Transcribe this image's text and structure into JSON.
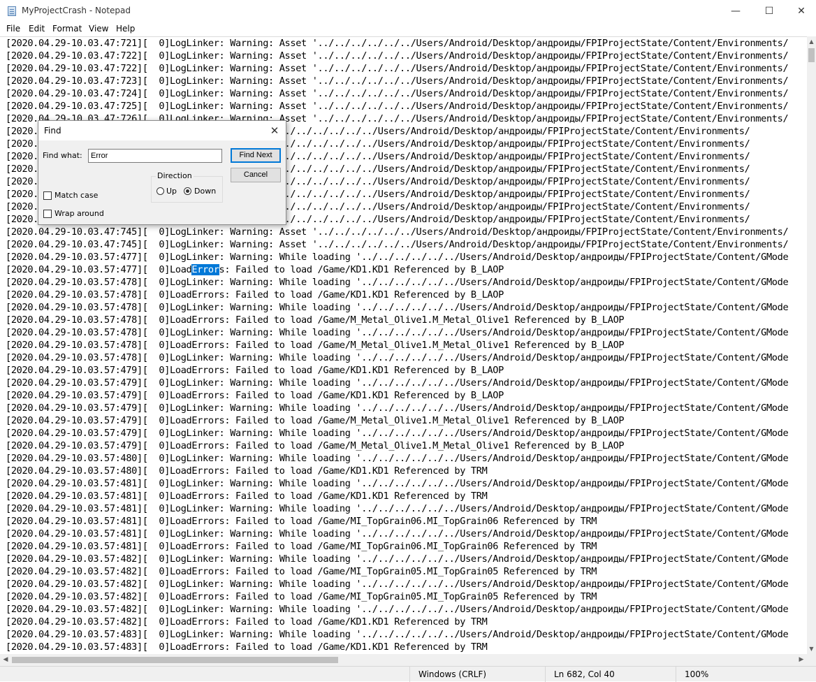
{
  "window": {
    "title": "MyProjectCrash - Notepad",
    "minimize_glyph": "—",
    "maximize_glyph": "☐",
    "close_glyph": "✕"
  },
  "menu": [
    "File",
    "Edit",
    "Format",
    "View",
    "Help"
  ],
  "editor": {
    "lines": [
      "[2020.04.29-10.03.47:721][  0]LogLinker: Warning: Asset '../../../../../../Users/Android/Desktop/андроиды/FPIProjectState/Content/Environments/",
      "[2020.04.29-10.03.47:722][  0]LogLinker: Warning: Asset '../../../../../../Users/Android/Desktop/андроиды/FPIProjectState/Content/Environments/",
      "[2020.04.29-10.03.47:722][  0]LogLinker: Warning: Asset '../../../../../../Users/Android/Desktop/андроиды/FPIProjectState/Content/Environments/",
      "[2020.04.29-10.03.47:723][  0]LogLinker: Warning: Asset '../../../../../../Users/Android/Desktop/андроиды/FPIProjectState/Content/Environments/",
      "[2020.04.29-10.03.47:724][  0]LogLinker: Warning: Asset '../../../../../../Users/Android/Desktop/андроиды/FPIProjectState/Content/Environments/",
      "[2020.04.29-10.03.47:725][  0]LogLinker: Warning: Asset '../../../../../../Users/Android/Desktop/андроиды/FPIProjectState/Content/Environments/",
      "[2020.04.29-10.03.47:726][  0]LogLinker: Warning: Asset '../../../../../../Users/Android/Desktop/андроиды/FPIProjectState/Content/Environments/",
      "[2020.                                     Asset '../../../../../../Users/Android/Desktop/андроиды/FPIProjectState/Content/Environments/",
      "[2020.                                     Asset '../../../../../../Users/Android/Desktop/андроиды/FPIProjectState/Content/Environments/",
      "[2020.                                     Asset '../../../../../../Users/Android/Desktop/андроиды/FPIProjectState/Content/Environments/",
      "[2020.                                     Asset '../../../../../../Users/Android/Desktop/андроиды/FPIProjectState/Content/Environments/",
      "[2020.                                     Asset '../../../../../../Users/Android/Desktop/андроиды/FPIProjectState/Content/Environments/",
      "[2020.                                     Asset '../../../../../../Users/Android/Desktop/андроиды/FPIProjectState/Content/Environments/",
      "[2020.                                     Asset '../../../../../../Users/Android/Desktop/андроиды/FPIProjectState/Content/Environments/",
      "[2020.                                     Asset '../../../../../../Users/Android/Desktop/андроиды/FPIProjectState/Content/Environments/",
      "[2020.04.29-10.03.47:745][  0]LogLinker: Warning: Asset '../../../../../../Users/Android/Desktop/андроиды/FPIProjectState/Content/Environments/",
      "[2020.04.29-10.03.47:745][  0]LogLinker: Warning: Asset '../../../../../../Users/Android/Desktop/андроиды/FPIProjectState/Content/Environments/",
      "[2020.04.29-10.03.57:477][  0]LogLinker: Warning: While loading '../../../../../../Users/Android/Desktop/андроиды/FPIProjectState/Content/GMode",
      "[2020.04.29-10.03.57:477][  0]LoadErrors: Failed to load /Game/KD1.KD1 Referenced by B_LAOP",
      "[2020.04.29-10.03.57:478][  0]LogLinker: Warning: While loading '../../../../../../Users/Android/Desktop/андроиды/FPIProjectState/Content/GMode",
      "[2020.04.29-10.03.57:478][  0]LoadErrors: Failed to load /Game/KD1.KD1 Referenced by B_LAOP",
      "[2020.04.29-10.03.57:478][  0]LogLinker: Warning: While loading '../../../../../../Users/Android/Desktop/андроиды/FPIProjectState/Content/GMode",
      "[2020.04.29-10.03.57:478][  0]LoadErrors: Failed to load /Game/M_Metal_Olive1.M_Metal_Olive1 Referenced by B_LAOP",
      "[2020.04.29-10.03.57:478][  0]LogLinker: Warning: While loading '../../../../../../Users/Android/Desktop/андроиды/FPIProjectState/Content/GMode",
      "[2020.04.29-10.03.57:478][  0]LoadErrors: Failed to load /Game/M_Metal_Olive1.M_Metal_Olive1 Referenced by B_LAOP",
      "[2020.04.29-10.03.57:478][  0]LogLinker: Warning: While loading '../../../../../../Users/Android/Desktop/андроиды/FPIProjectState/Content/GMode",
      "[2020.04.29-10.03.57:479][  0]LoadErrors: Failed to load /Game/KD1.KD1 Referenced by B_LAOP",
      "[2020.04.29-10.03.57:479][  0]LogLinker: Warning: While loading '../../../../../../Users/Android/Desktop/андроиды/FPIProjectState/Content/GMode",
      "[2020.04.29-10.03.57:479][  0]LoadErrors: Failed to load /Game/KD1.KD1 Referenced by B_LAOP",
      "[2020.04.29-10.03.57:479][  0]LogLinker: Warning: While loading '../../../../../../Users/Android/Desktop/андроиды/FPIProjectState/Content/GMode",
      "[2020.04.29-10.03.57:479][  0]LoadErrors: Failed to load /Game/M_Metal_Olive1.M_Metal_Olive1 Referenced by B_LAOP",
      "[2020.04.29-10.03.57:479][  0]LogLinker: Warning: While loading '../../../../../../Users/Android/Desktop/андроиды/FPIProjectState/Content/GMode",
      "[2020.04.29-10.03.57:479][  0]LoadErrors: Failed to load /Game/M_Metal_Olive1.M_Metal_Olive1 Referenced by B_LAOP",
      "[2020.04.29-10.03.57:480][  0]LogLinker: Warning: While loading '../../../../../../Users/Android/Desktop/андроиды/FPIProjectState/Content/GMode",
      "[2020.04.29-10.03.57:480][  0]LoadErrors: Failed to load /Game/KD1.KD1 Referenced by TRM",
      "[2020.04.29-10.03.57:481][  0]LogLinker: Warning: While loading '../../../../../../Users/Android/Desktop/андроиды/FPIProjectState/Content/GMode",
      "[2020.04.29-10.03.57:481][  0]LoadErrors: Failed to load /Game/KD1.KD1 Referenced by TRM",
      "[2020.04.29-10.03.57:481][  0]LogLinker: Warning: While loading '../../../../../../Users/Android/Desktop/андроиды/FPIProjectState/Content/GMode",
      "[2020.04.29-10.03.57:481][  0]LoadErrors: Failed to load /Game/MI_TopGrain06.MI_TopGrain06 Referenced by TRM",
      "[2020.04.29-10.03.57:481][  0]LogLinker: Warning: While loading '../../../../../../Users/Android/Desktop/андроиды/FPIProjectState/Content/GMode",
      "[2020.04.29-10.03.57:481][  0]LoadErrors: Failed to load /Game/MI_TopGrain06.MI_TopGrain06 Referenced by TRM",
      "[2020.04.29-10.03.57:482][  0]LogLinker: Warning: While loading '../../../../../../Users/Android/Desktop/андроиды/FPIProjectState/Content/GMode",
      "[2020.04.29-10.03.57:482][  0]LoadErrors: Failed to load /Game/MI_TopGrain05.MI_TopGrain05 Referenced by TRM",
      "[2020.04.29-10.03.57:482][  0]LogLinker: Warning: While loading '../../../../../../Users/Android/Desktop/андроиды/FPIProjectState/Content/GMode",
      "[2020.04.29-10.03.57:482][  0]LoadErrors: Failed to load /Game/MI_TopGrain05.MI_TopGrain05 Referenced by TRM",
      "[2020.04.29-10.03.57:482][  0]LogLinker: Warning: While loading '../../../../../../Users/Android/Desktop/андроиды/FPIProjectState/Content/GMode",
      "[2020.04.29-10.03.57:482][  0]LoadErrors: Failed to load /Game/KD1.KD1 Referenced by TRM",
      "[2020.04.29-10.03.57:483][  0]LogLinker: Warning: While loading '../../../../../../Users/Android/Desktop/андроиды/FPIProjectState/Content/GMode",
      "[2020.04.29-10.03.57:483][  0]LoadErrors: Failed to load /Game/KD1.KD1 Referenced by TRM"
    ],
    "selection": {
      "line": 18,
      "text": "Error"
    }
  },
  "find_dialog": {
    "title": "Find",
    "close_glyph": "✕",
    "find_what_label": "Find what:",
    "find_what_value": "Error",
    "find_next_label": "Find Next",
    "cancel_label": "Cancel",
    "direction_label": "Direction",
    "up_label": "Up",
    "down_label": "Down",
    "direction_selected": "Down",
    "match_case_label": "Match case",
    "match_case_checked": false,
    "wrap_around_label": "Wrap around",
    "wrap_around_checked": false
  },
  "statusbar": {
    "line_ending": "Windows (CRLF)",
    "position": "Ln 682, Col 40",
    "zoom": "100%"
  }
}
